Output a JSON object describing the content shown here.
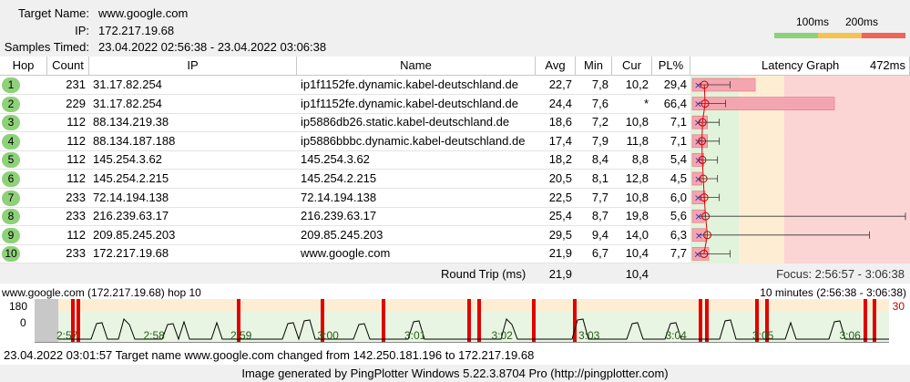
{
  "header": {
    "target_label": "Target Name:",
    "target_value": "www.google.com",
    "ip_label": "IP:",
    "ip_value": "172.217.19.68",
    "samples_label": "Samples Timed:",
    "samples_value": "23.04.2022 02:56:38 - 23.04.2022 03:06:38",
    "legend_100": "100ms",
    "legend_200": "200ms"
  },
  "colors": {
    "good": "#8fd17a",
    "warn": "#f5c34f",
    "bad": "#f0645a",
    "bar": "#f4a6b0",
    "bad_zone": "#fbd4d4",
    "warn_zone": "#fdeed3",
    "good_zone": "#e1f3da"
  },
  "table": {
    "columns": [
      "Hop",
      "Count",
      "IP",
      "Name",
      "Avg",
      "Min",
      "Cur",
      "PL%",
      "Latency Graph"
    ],
    "graph_max": "472ms",
    "rows": [
      {
        "hop": "1",
        "count": "231",
        "ip": "31.17.82.254",
        "name": "ip1f1152fe.dynamic.kabel-deutschland.de",
        "avg": "22,7",
        "min": "7,8",
        "cur": "10,2",
        "pl": "29,4",
        "pl_v": 29.4,
        "avg_v": 22.7,
        "min_v": 7.8,
        "max_v": 80
      },
      {
        "hop": "2",
        "count": "229",
        "ip": "31.17.82.254",
        "name": "ip1f1152fe.dynamic.kabel-deutschland.de",
        "avg": "24,4",
        "min": "7,6",
        "cur": "*",
        "pl": "66,4",
        "pl_v": 66.4,
        "avg_v": 24.4,
        "min_v": 7.6,
        "max_v": 70
      },
      {
        "hop": "3",
        "count": "112",
        "ip": "88.134.219.38",
        "name": "ip5886db26.static.kabel-deutschland.de",
        "avg": "18,6",
        "min": "7,2",
        "cur": "10,8",
        "pl": "7,1",
        "pl_v": 7.1,
        "avg_v": 18.6,
        "min_v": 7.2,
        "max_v": 56
      },
      {
        "hop": "4",
        "count": "112",
        "ip": "88.134.187.188",
        "name": "ip5886bbbc.dynamic.kabel-deutschland.de",
        "avg": "17,4",
        "min": "7,9",
        "cur": "11,8",
        "pl": "7,1",
        "pl_v": 7.1,
        "avg_v": 17.4,
        "min_v": 7.9,
        "max_v": 56
      },
      {
        "hop": "5",
        "count": "112",
        "ip": "145.254.3.62",
        "name": "145.254.3.62",
        "avg": "18,2",
        "min": "8,4",
        "cur": "8,8",
        "pl": "5,4",
        "pl_v": 5.4,
        "avg_v": 18.2,
        "min_v": 8.4,
        "max_v": 52
      },
      {
        "hop": "6",
        "count": "112",
        "ip": "145.254.2.215",
        "name": "145.254.2.215",
        "avg": "20,5",
        "min": "8,1",
        "cur": "12,8",
        "pl": "4,5",
        "pl_v": 4.5,
        "avg_v": 20.5,
        "min_v": 8.1,
        "max_v": 52
      },
      {
        "hop": "7",
        "count": "233",
        "ip": "72.14.194.138",
        "name": "72.14.194.138",
        "avg": "22,5",
        "min": "7,7",
        "cur": "10,8",
        "pl": "6,0",
        "pl_v": 6.0,
        "avg_v": 22.5,
        "min_v": 7.7,
        "max_v": 56
      },
      {
        "hop": "8",
        "count": "233",
        "ip": "216.239.63.17",
        "name": "216.239.63.17",
        "avg": "25,4",
        "min": "8,7",
        "cur": "19,8",
        "pl": "5,6",
        "pl_v": 5.6,
        "avg_v": 25.4,
        "min_v": 8.7,
        "max_v": 470
      },
      {
        "hop": "9",
        "count": "112",
        "ip": "209.85.245.203",
        "name": "209.85.245.203",
        "avg": "29,5",
        "min": "9,4",
        "cur": "14,0",
        "pl": "6,3",
        "pl_v": 6.3,
        "avg_v": 29.5,
        "min_v": 9.4,
        "max_v": 390
      },
      {
        "hop": "10",
        "count": "233",
        "ip": "172.217.19.68",
        "name": "www.google.com",
        "avg": "21,9",
        "min": "6,7",
        "cur": "10,4",
        "pl": "7,7",
        "pl_v": 7.7,
        "avg_v": 21.9,
        "min_v": 6.7,
        "max_v": 80
      }
    ],
    "round_trip": {
      "label": "Round Trip (ms)",
      "avg": "21,9",
      "cur": "10,4"
    },
    "focus": "Focus: 2:56:57 - 3:06:38"
  },
  "timeline": {
    "title": "www.google.com (172.217.19.68) hop 10",
    "range": "10 minutes (2:56:38 - 3:06:38)",
    "y_max": "180",
    "y_min": "0",
    "pl_max": "30",
    "ticks": [
      "2:57",
      "2:58",
      "2:59",
      "3:00",
      "3:01",
      "3:02",
      "3:03",
      "3:04",
      "3:05",
      "3:06"
    ]
  },
  "status_line": "23.04.2022 03:01:57 Target name www.google.com changed from 142.250.181.196 to 172.217.19.68",
  "generated_by": "Image generated by PingPlotter Windows 5.22.3.8704 Pro (http://pingplotter.com)"
}
